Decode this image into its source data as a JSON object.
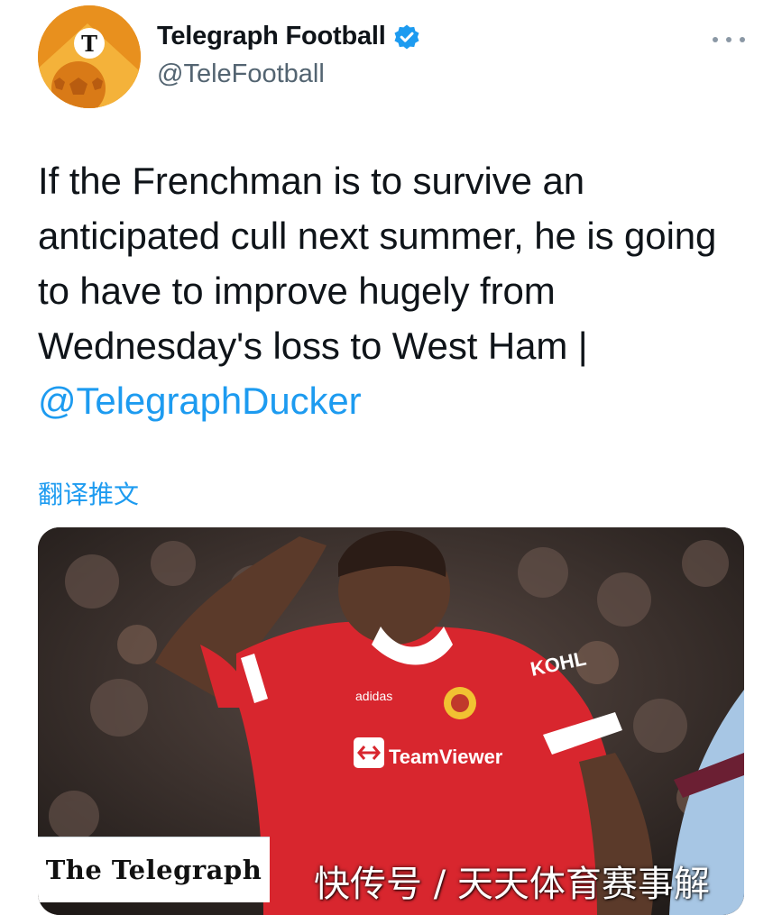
{
  "account": {
    "display_name": "Telegraph Football",
    "handle": "@TeleFootball",
    "verified": true,
    "avatar_icon": "telegraph-football-logo"
  },
  "tweet": {
    "text": "If the Frenchman is to survive an anticipated cull next summer, he is going to have to improve hugely from Wednesday's loss to West Ham | ",
    "mention": "@TelegraphDucker",
    "translate_label": "翻译推文"
  },
  "media": {
    "kit_sponsor": "TeamViewer",
    "sleeve_text": "KOHL",
    "publisher_label": "The Telegraph"
  },
  "watermark": "快传号 / 天天体育赛事解",
  "colors": {
    "link": "#1d9bf0",
    "text": "#0f1419",
    "secondary": "#536471",
    "shirt_red": "#d8262e"
  }
}
